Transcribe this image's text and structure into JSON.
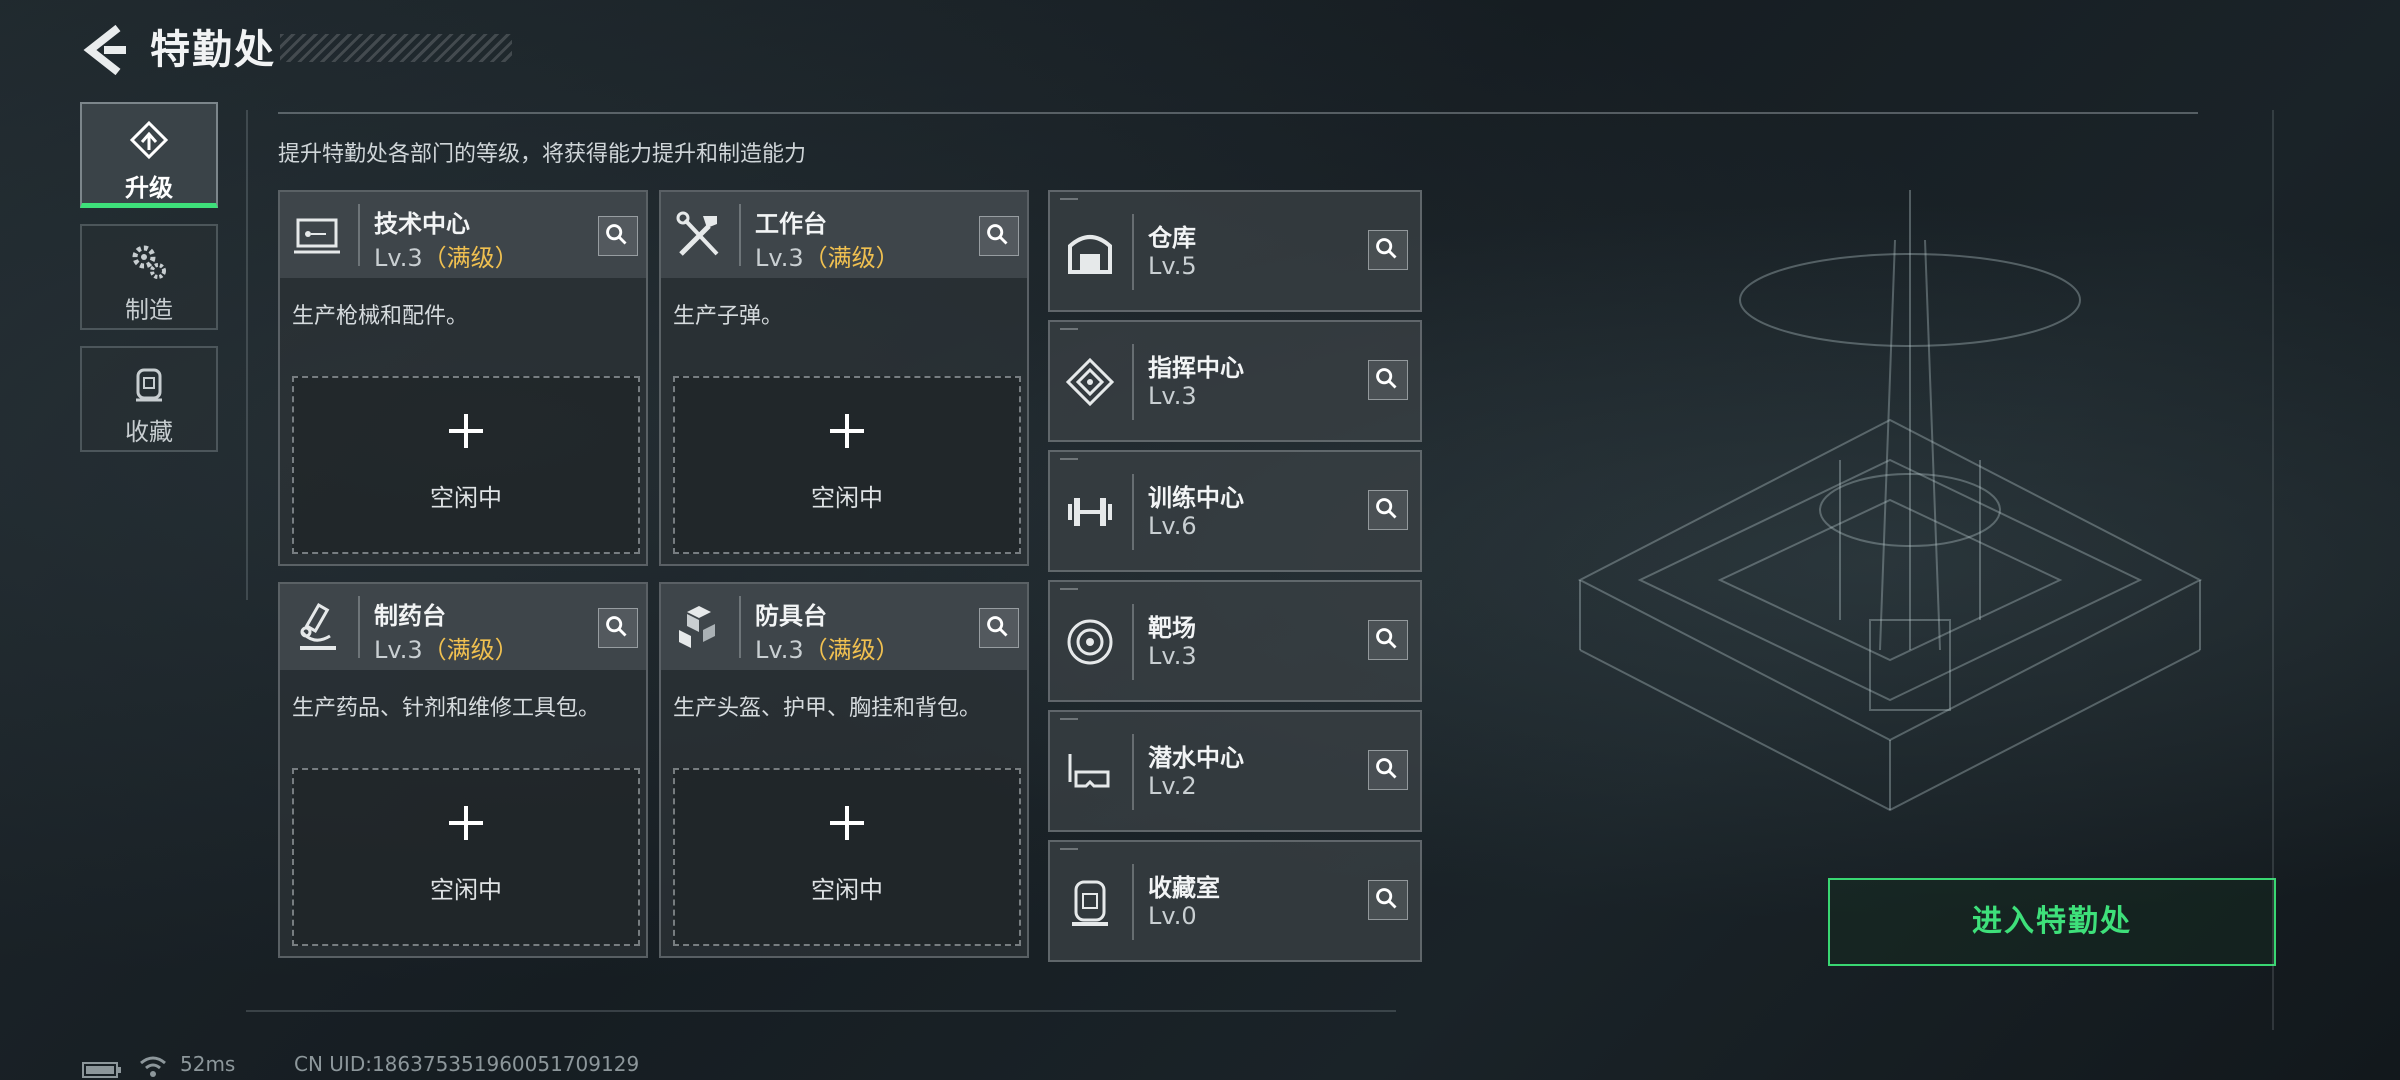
{
  "header": {
    "title": "特勤处"
  },
  "nav": [
    {
      "label": "升级",
      "icon": "upgrade-icon",
      "active": true
    },
    {
      "label": "制造",
      "icon": "craft-gear-icon",
      "active": false
    },
    {
      "label": "收藏",
      "icon": "collection-icon",
      "active": false
    }
  ],
  "subtitle": "提升特勤处各部门的等级，将获得能力提升和制造能力",
  "stations": [
    {
      "name": "技术中心",
      "level": "Lv.3",
      "max": "（满级）",
      "desc": "生产枪械和配件。",
      "slot": "空闲中",
      "icon": "tech-center-icon"
    },
    {
      "name": "工作台",
      "level": "Lv.3",
      "max": "（满级）",
      "desc": "生产子弹。",
      "slot": "空闲中",
      "icon": "workbench-tools-icon"
    },
    {
      "name": "制药台",
      "level": "Lv.3",
      "max": "（满级）",
      "desc": "生产药品、针剂和维修工具包。",
      "slot": "空闲中",
      "icon": "microscope-icon"
    },
    {
      "name": "防具台",
      "level": "Lv.3",
      "max": "（满级）",
      "desc": "生产头盔、护甲、胸挂和背包。",
      "slot": "空闲中",
      "icon": "armor-cubes-icon"
    }
  ],
  "facilities": [
    {
      "name": "仓库",
      "level": "Lv.5",
      "icon": "warehouse-icon"
    },
    {
      "name": "指挥中心",
      "level": "Lv.3",
      "icon": "chip-icon"
    },
    {
      "name": "训练中心",
      "level": "Lv.6",
      "icon": "dumbbell-icon"
    },
    {
      "name": "靶场",
      "level": "Lv.3",
      "icon": "target-icon"
    },
    {
      "name": "潜水中心",
      "level": "Lv.2",
      "icon": "diving-mask-icon"
    },
    {
      "name": "收藏室",
      "level": "Lv.0",
      "icon": "display-case-icon"
    }
  ],
  "enter_button": "进入特勤处",
  "status": {
    "ping": "52ms",
    "uid": "CN UID:186375351960051709129"
  },
  "colors": {
    "accent_green": "#3ee07a",
    "max_level_gold": "#f0c050"
  }
}
